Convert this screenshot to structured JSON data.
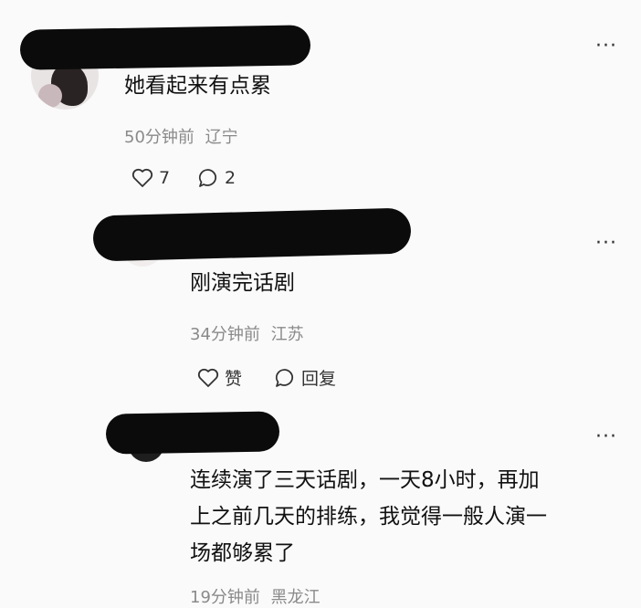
{
  "comments": [
    {
      "text": "她看起来有点累",
      "time": "50分钟前",
      "location": "辽宁",
      "likes": "7",
      "replies": "2",
      "more": "···"
    },
    {
      "text": "刚演完话剧",
      "time": "34分钟前",
      "location": "江苏",
      "like_label": "赞",
      "reply_label": "回复",
      "more": "···"
    },
    {
      "text_lines": [
        "连续演了三天话剧，一天8小时，再加",
        "上之前几天的排练，我觉得一般人演一",
        "场都够累了"
      ],
      "time": "19分钟前",
      "location": "黑龙江",
      "more": "···"
    }
  ],
  "colors": {
    "background": "#fafafa",
    "text": "#111111",
    "meta": "#8a8a8a",
    "redaction": "#0b0b0b"
  }
}
